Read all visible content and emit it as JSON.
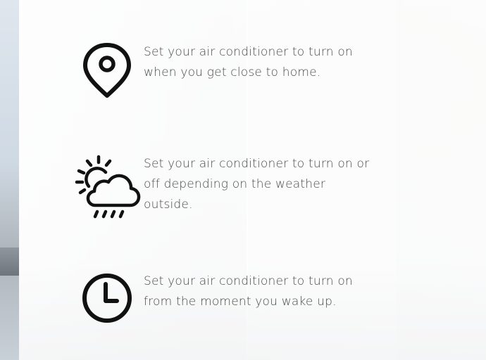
{
  "features": [
    {
      "icon": "location-pin-icon",
      "text": "Set your air conditioner to turn on when you get close to home."
    },
    {
      "icon": "weather-sun-cloud-rain-icon",
      "text": "Set your air conditioner to turn on or off depending on the weather outside."
    },
    {
      "icon": "clock-icon",
      "text": "Set your air conditioner to turn on from the moment you wake up."
    }
  ]
}
